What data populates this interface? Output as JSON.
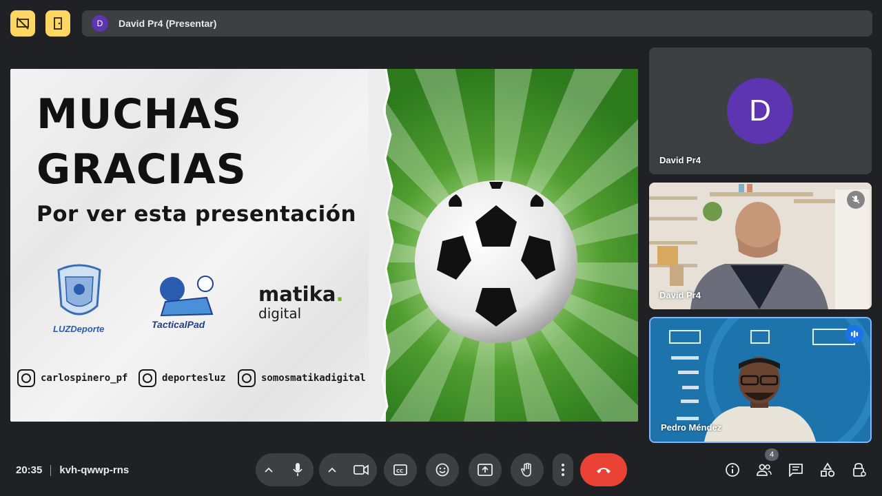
{
  "top_bar": {
    "presenter_initial": "D",
    "presenter_label": "David Pr4 (Presentar)"
  },
  "slide": {
    "title_line1": "MUCHAS",
    "title_line2": "GRACIAS",
    "subtitle": "Por ver esta presentación",
    "logos": {
      "luz": "LUZDeporte",
      "tacticalpad": "TacticalPad",
      "matika_main": "matika",
      "matika_dot": ".",
      "matika_sub": "digital"
    },
    "socials": [
      "carlospinero_pf",
      "deportesluz",
      "somosmatikadigital"
    ]
  },
  "participants": [
    {
      "name": "David Pr4",
      "initial": "D",
      "type": "avatar"
    },
    {
      "name": "David Pr4",
      "type": "video",
      "muted": true
    },
    {
      "name": "Pedro Méndez",
      "type": "video",
      "speaking": true
    }
  ],
  "bottom_bar": {
    "time": "20:35",
    "meeting_code": "kvh-qwwp-rns",
    "participant_count": "4"
  },
  "colors": {
    "background": "#202124",
    "accent_yellow": "#fdd663",
    "end_call": "#ea4335",
    "avatar": "#5e35b1"
  }
}
